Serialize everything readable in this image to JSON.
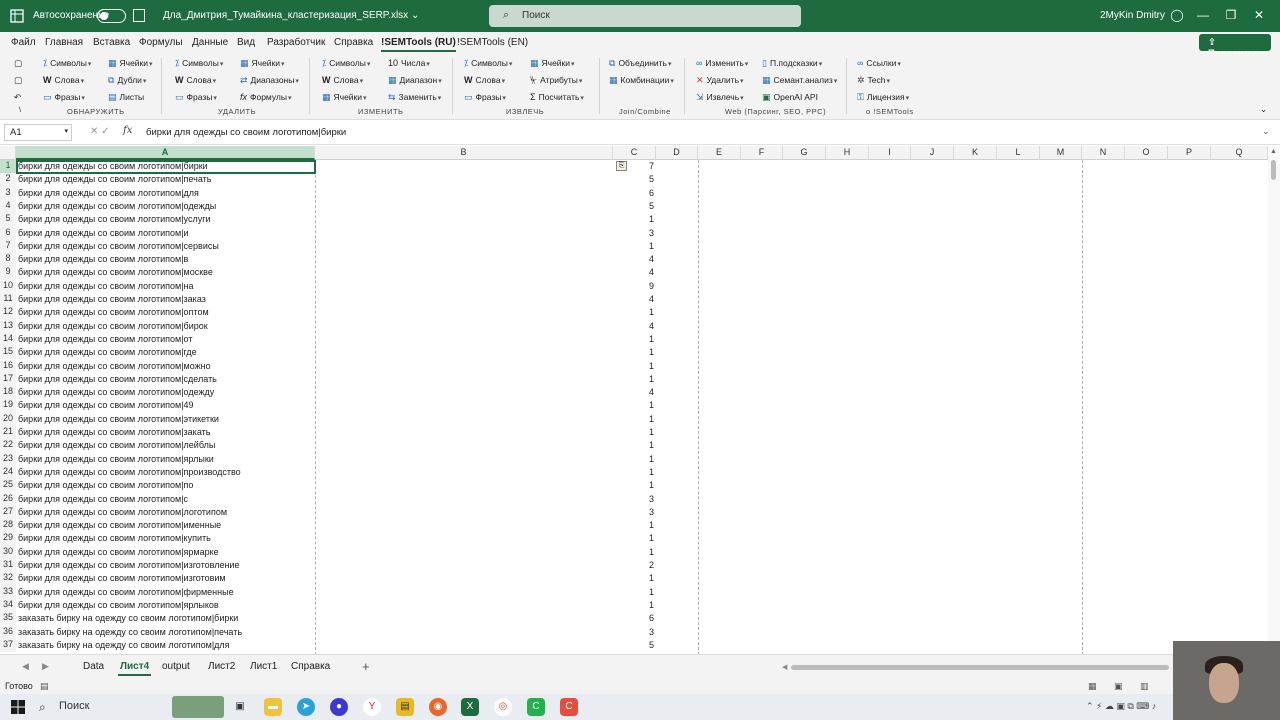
{
  "titlebar": {
    "autosave_label": "Автосохранение",
    "document_title": "Дла_Дмитрия_Тумайкина_кластеризация_SERP.xlsx",
    "title_dropdown": "⌄",
    "search_placeholder": "Поиск",
    "user_name": "2MyKin Dmitry"
  },
  "menu": {
    "tabs": [
      "Файл",
      "Главная",
      "Вставка",
      "Формулы",
      "Данные",
      "Вид",
      "Разработчик",
      "Справка",
      "!SEMTools (RU)",
      "!SEMTools (EN)"
    ],
    "active_tab": "!SEMTools (RU)",
    "share_label": "Поделиться"
  },
  "ribbon": {
    "g1": {
      "b1": "Символы",
      "b2": "Слова",
      "b3": "Фразы",
      "b4": "Ячейки",
      "b5": "Дубли",
      "b6": "Листы",
      "label": "ОБНАРУЖИТЬ"
    },
    "g2": {
      "b1": "Символы",
      "b2": "Слова",
      "b3": "Фразы",
      "b4": "Ячейки",
      "b5": "Диапазоны",
      "b6": "Формулы",
      "label": "УДАЛИТЬ"
    },
    "g3": {
      "b1": "Символы",
      "b2": "Слова",
      "b3": "Ячейки",
      "b4": "Числа",
      "b5": "Диапазон",
      "b6": "Заменить",
      "label": "ИЗМЕНИТЬ"
    },
    "g4": {
      "b1": "Символы",
      "b2": "Слова",
      "b3": "Фразы",
      "b4": "Ячейки",
      "b5": "Атрибуты",
      "b6": "Посчитать",
      "label": "ИЗВЛЕЧЬ"
    },
    "g5": {
      "b1": "Объединить",
      "b2": "Комбинации",
      "label": "Join/Combine"
    },
    "g6": {
      "b1": "Изменить",
      "b2": "Удалить",
      "b3": "Извлечь",
      "b4": "П.подсказки",
      "b5": "Семант.анализ",
      "b6": "OpenAI API",
      "label": "Web (Парсинг, SEO, PPC)"
    },
    "g7": {
      "b1": "Ссылки",
      "b2": "Tech",
      "b3": "Лицензия",
      "label": "о !SEMTools"
    }
  },
  "formula_bar": {
    "name_box": "A1",
    "formula": "бирки для одежды со своим логотипом|бирки"
  },
  "columns": [
    "A",
    "B",
    "C",
    "D",
    "E",
    "F",
    "G",
    "H",
    "I",
    "J",
    "K",
    "L",
    "M",
    "N",
    "O",
    "P",
    "Q"
  ],
  "rows": [
    {
      "n": "1",
      "a": "бирки для одежды со своим логотипом|бирки",
      "c": "7"
    },
    {
      "n": "2",
      "a": "бирки для одежды со своим логотипом|печать",
      "c": "5"
    },
    {
      "n": "3",
      "a": "бирки для одежды со своим логотипом|для",
      "c": "6"
    },
    {
      "n": "4",
      "a": "бирки для одежды со своим логотипом|одежды",
      "c": "5"
    },
    {
      "n": "5",
      "a": "бирки для одежды со своим логотипом|услуги",
      "c": "1"
    },
    {
      "n": "6",
      "a": "бирки для одежды со своим логотипом|и",
      "c": "3"
    },
    {
      "n": "7",
      "a": "бирки для одежды со своим логотипом|сервисы",
      "c": "1"
    },
    {
      "n": "8",
      "a": "бирки для одежды со своим логотипом|в",
      "c": "4"
    },
    {
      "n": "9",
      "a": "бирки для одежды со своим логотипом|москве",
      "c": "4"
    },
    {
      "n": "10",
      "a": "бирки для одежды со своим логотипом|на",
      "c": "9"
    },
    {
      "n": "11",
      "a": "бирки для одежды со своим логотипом|заказ",
      "c": "4"
    },
    {
      "n": "12",
      "a": "бирки для одежды со своим логотипом|оптом",
      "c": "1"
    },
    {
      "n": "13",
      "a": "бирки для одежды со своим логотипом|бирок",
      "c": "4"
    },
    {
      "n": "14",
      "a": "бирки для одежды со своим логотипом|от",
      "c": "1"
    },
    {
      "n": "15",
      "a": "бирки для одежды со своим логотипом|где",
      "c": "1"
    },
    {
      "n": "16",
      "a": "бирки для одежды со своим логотипом|можно",
      "c": "1"
    },
    {
      "n": "17",
      "a": "бирки для одежды со своим логотипом|сделать",
      "c": "1"
    },
    {
      "n": "18",
      "a": "бирки для одежды со своим логотипом|одежду",
      "c": "4"
    },
    {
      "n": "19",
      "a": "бирки для одежды со своим логотипом|49",
      "c": "1"
    },
    {
      "n": "20",
      "a": "бирки для одежды со своим логотипом|этикетки",
      "c": "1"
    },
    {
      "n": "21",
      "a": "бирки для одежды со своим логотипом|закать",
      "c": "1"
    },
    {
      "n": "22",
      "a": "бирки для одежды со своим логотипом|лейблы",
      "c": "1"
    },
    {
      "n": "23",
      "a": "бирки для одежды со своим логотипом|ярлыки",
      "c": "1"
    },
    {
      "n": "24",
      "a": "бирки для одежды со своим логотипом|производство",
      "c": "1"
    },
    {
      "n": "25",
      "a": "бирки для одежды со своим логотипом|по",
      "c": "1"
    },
    {
      "n": "26",
      "a": "бирки для одежды со своим логотипом|с",
      "c": "3"
    },
    {
      "n": "27",
      "a": "бирки для одежды со своим логотипом|логотипом",
      "c": "3"
    },
    {
      "n": "28",
      "a": "бирки для одежды со своим логотипом|именные",
      "c": "1"
    },
    {
      "n": "29",
      "a": "бирки для одежды со своим логотипом|купить",
      "c": "1"
    },
    {
      "n": "30",
      "a": "бирки для одежды со своим логотипом|ярмарке",
      "c": "1"
    },
    {
      "n": "31",
      "a": "бирки для одежды со своим логотипом|изготовление",
      "c": "2"
    },
    {
      "n": "32",
      "a": "бирки для одежды со своим логотипом|изготовим",
      "c": "1"
    },
    {
      "n": "33",
      "a": "бирки для одежды со своим логотипом|фирменные",
      "c": "1"
    },
    {
      "n": "34",
      "a": "бирки для одежды со своим логотипом|ярлыков",
      "c": "1"
    },
    {
      "n": "35",
      "a": "заказать бирку на одежду со своим логотипом|бирки",
      "c": "6"
    },
    {
      "n": "36",
      "a": "заказать бирку на одежду со своим логотипом|печать",
      "c": "3"
    },
    {
      "n": "37",
      "a": "заказать бирку на одежду со своим логотипом|для",
      "c": "5"
    }
  ],
  "sheets": [
    "Data",
    "Лист4",
    "output",
    "Лист2",
    "Лист1",
    "Справка"
  ],
  "active_sheet": "Лист4",
  "status": {
    "ready": "Готово"
  },
  "taskbar": {
    "search_placeholder": "Поиск"
  },
  "colors": {
    "excel_green": "#1e6b40",
    "selected_header": "#c4dfcc"
  }
}
